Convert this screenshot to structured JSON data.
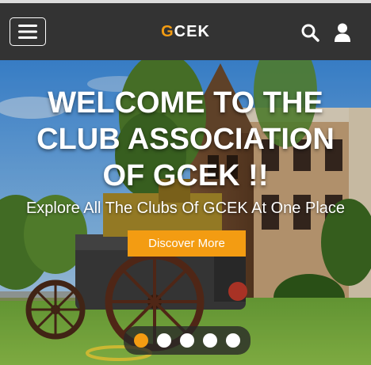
{
  "navbar": {
    "brand_prefix": "G",
    "brand_suffix": "CEK",
    "accent_color": "#f39c12",
    "background_color": "#333333",
    "icons": [
      "hamburger-menu-icon",
      "search-icon",
      "user-icon"
    ]
  },
  "hero": {
    "title_line1": "WELCOME TO THE",
    "title_line2": "CLUB ASSOCIATION",
    "title_line3": "OF GCEK !!",
    "subtitle": "Explore All The Clubs Of GCEK At One Place",
    "cta_label": "Discover More",
    "carousel": {
      "slide_count": 5,
      "active_index": 0
    }
  }
}
